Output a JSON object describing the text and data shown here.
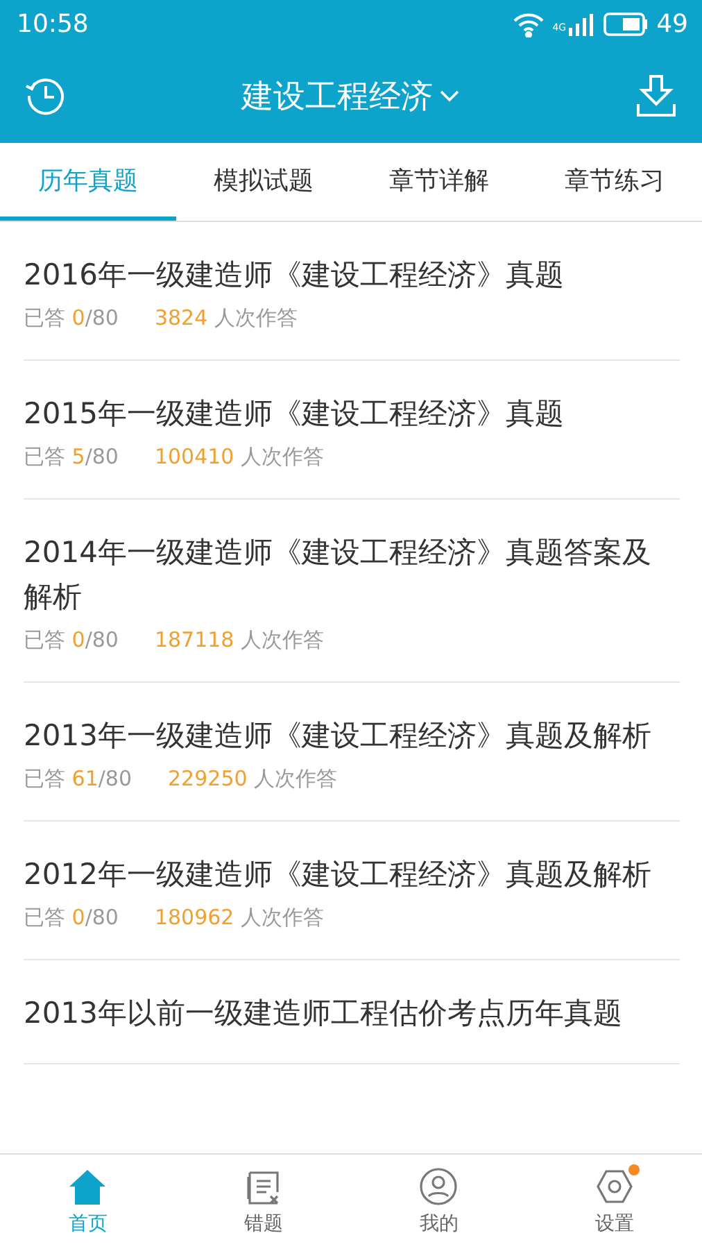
{
  "status_bar": {
    "time": "10:58",
    "network": "4G",
    "battery": "49"
  },
  "header": {
    "title": "建设工程经济"
  },
  "tabs": [
    {
      "label": "历年真题",
      "selected": true
    },
    {
      "label": "模拟试题",
      "selected": false
    },
    {
      "label": "章节详解",
      "selected": false
    },
    {
      "label": "章节练习",
      "selected": false
    }
  ],
  "papers": [
    {
      "title": "2016年一级建造师《建设工程经济》真题",
      "answered_label": "已答",
      "answered": "0",
      "total": "/80",
      "attempts": "3824",
      "attempts_label": "人次作答"
    },
    {
      "title": "2015年一级建造师《建设工程经济》真题",
      "answered_label": "已答",
      "answered": "5",
      "total": "/80",
      "attempts": "100410",
      "attempts_label": "人次作答"
    },
    {
      "title": "2014年一级建造师《建设工程经济》真题答案及解析",
      "answered_label": "已答",
      "answered": "0",
      "total": "/80",
      "attempts": "187118",
      "attempts_label": "人次作答"
    },
    {
      "title": "2013年一级建造师《建设工程经济》真题及解析",
      "answered_label": "已答",
      "answered": "61",
      "total": "/80",
      "attempts": "229250",
      "attempts_label": "人次作答"
    },
    {
      "title": "2012年一级建造师《建设工程经济》真题及解析",
      "answered_label": "已答",
      "answered": "0",
      "total": "/80",
      "attempts": "180962",
      "attempts_label": "人次作答"
    },
    {
      "title": "2013年以前一级建造师工程估价考点历年真题"
    }
  ],
  "bottom_nav": [
    {
      "label": "首页",
      "kind": "home",
      "selected": true,
      "badge": false
    },
    {
      "label": "错题",
      "kind": "mistakes",
      "selected": false,
      "badge": false
    },
    {
      "label": "我的",
      "kind": "profile",
      "selected": false,
      "badge": false
    },
    {
      "label": "设置",
      "kind": "settings",
      "selected": false,
      "badge": true
    }
  ]
}
